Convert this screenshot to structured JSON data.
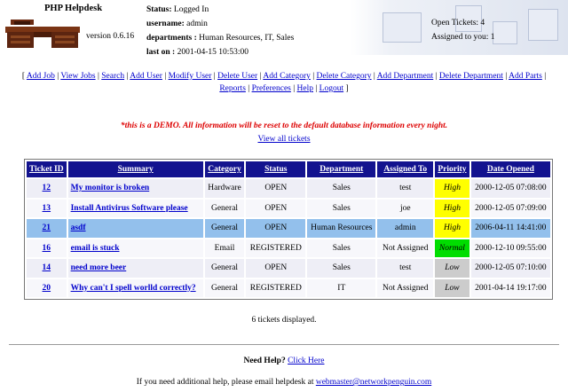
{
  "header": {
    "title": "PHP Helpdesk",
    "version": "version 0.6.16",
    "status_label": "Status:",
    "status_value": "Logged In",
    "username_label": "username:",
    "username_value": "admin",
    "departments_label": "departments :",
    "departments_value": "Human Resources, IT, Sales",
    "last_on_label": "last on :",
    "last_on_value": "2001-04-15 10:53:00",
    "open_tickets": "Open Tickets: 4",
    "assigned_to_you": "Assigned to you: 1"
  },
  "nav": {
    "items": [
      "Add Job",
      "View Jobs",
      "Search",
      "Add User",
      "Modify User",
      "Delete User",
      "Add Category",
      "Delete Category",
      "Add Department",
      "Delete Department",
      "Add Parts",
      "Reports",
      "Preferences",
      "Help",
      "Logout"
    ]
  },
  "demo_notice": "*this is a DEMO. All information will be reset to the default database information every night.",
  "view_all": "View all tickets",
  "table": {
    "headers": [
      "Ticket ID",
      "Summary",
      "Category",
      "Status",
      "Department",
      "Assigned To",
      "Priority",
      "Date Opened"
    ],
    "rows": [
      {
        "id": "12",
        "summary": "My monitor is broken",
        "category": "Hardware",
        "status": "OPEN",
        "department": "Sales",
        "assigned": "test",
        "priority": "High",
        "priority_color": "#ffff00",
        "date": "2000-12-05 07:08:00"
      },
      {
        "id": "13",
        "summary": "Install Antivirus Software please",
        "category": "General",
        "status": "OPEN",
        "department": "Sales",
        "assigned": "joe",
        "priority": "High",
        "priority_color": "#ffff00",
        "date": "2000-12-05 07:09:00"
      },
      {
        "id": "21",
        "summary": "asdf",
        "category": "General",
        "status": "OPEN",
        "department": "Human Resources",
        "assigned": "admin",
        "priority": "High",
        "priority_color": "#ffff00",
        "date": "2006-04-11 14:41:00"
      },
      {
        "id": "16",
        "summary": "email is stuck",
        "category": "Email",
        "status": "REGISTERED",
        "department": "Sales",
        "assigned": "Not Assigned",
        "priority": "Normal",
        "priority_color": "#00dd00",
        "date": "2000-12-10 09:55:00"
      },
      {
        "id": "14",
        "summary": "need more beer",
        "category": "General",
        "status": "OPEN",
        "department": "Sales",
        "assigned": "test",
        "priority": "Low",
        "priority_color": "#cccccc",
        "date": "2000-12-05 07:10:00"
      },
      {
        "id": "20",
        "summary": "Why can't I spell worlld correctly?",
        "category": "General",
        "status": "REGISTERED",
        "department": "IT",
        "assigned": "Not Assigned",
        "priority": "Low",
        "priority_color": "#cccccc",
        "date": "2001-04-14 19:17:00"
      }
    ]
  },
  "count_text": "6 tickets displayed.",
  "footer": {
    "need_help": "Need Help?",
    "click_here": "Click Here",
    "email_text": "If you need additional help, please email helpdesk at",
    "email": "webmaster@networkpenguin.com"
  },
  "colors": {
    "table_header": "#13138f",
    "highlight_row": "#93c0ec",
    "demo_text": "#dd0000",
    "link": "#0000cc"
  }
}
